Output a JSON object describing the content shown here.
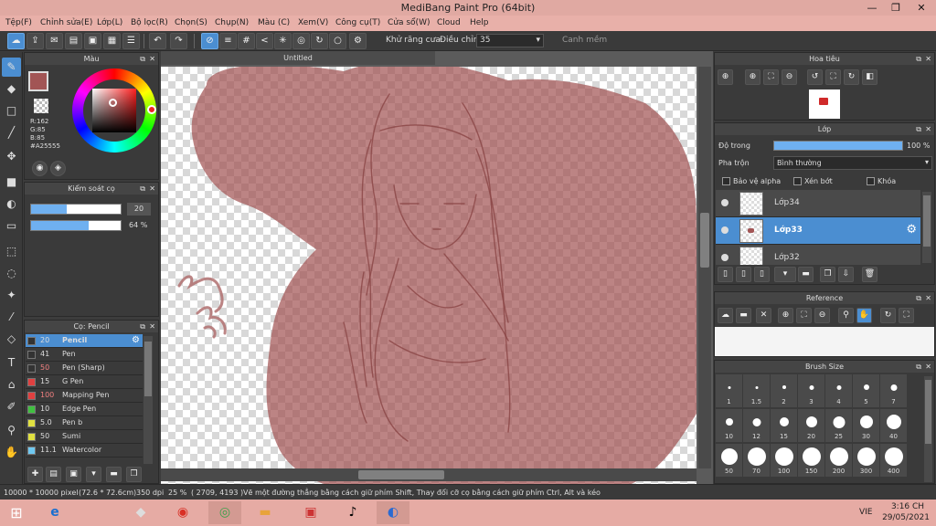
{
  "window": {
    "title": "MediBang Paint Pro (64bit)",
    "minimize": "—",
    "restore": "❐",
    "close": "✕"
  },
  "menu": [
    "Tệp(F)",
    "Chỉnh sửa(E)",
    "Lớp(L)",
    "Bộ lọc(R)",
    "Chọn(S)",
    "Chụp(N)",
    "Màu (C)",
    "Xem(V)",
    "Công cụ(T)",
    "Cửa sổ(W)",
    "Cloud",
    "Help"
  ],
  "toolbar": {
    "antialias_label": "Khử răng cưa",
    "adjust_label": "Điều chỉnh",
    "adjust_value": "35",
    "edge_label": "Canh mềm"
  },
  "color_panel": {
    "title": "Màu",
    "r": "R:162",
    "g": "G:85",
    "b": "B:85",
    "hex": "#A25555",
    "primary": "#A25555"
  },
  "brush_control": {
    "title": "Kiểm soát cọ",
    "size": "20",
    "opacity": "64 %",
    "opacity_value": 0.64,
    "size_value": 0.4
  },
  "brush_panel": {
    "title": "Cọ: Pencil",
    "items": [
      {
        "size": "20",
        "name": "Pencil",
        "color": "#333333"
      },
      {
        "size": "41",
        "name": "Pen",
        "color": "#333333"
      },
      {
        "size": "50",
        "name": "Pen (Sharp)",
        "color": "#333333"
      },
      {
        "size": "15",
        "name": "G Pen",
        "color": "#e04040"
      },
      {
        "size": "100",
        "name": "Mapping Pen",
        "color": "#e04040"
      },
      {
        "size": "10",
        "name": "Edge Pen",
        "color": "#40c040"
      },
      {
        "size": "5.0",
        "name": "Pen b",
        "color": "#e0e040"
      },
      {
        "size": "50",
        "name": "Sumi",
        "color": "#e0e040"
      },
      {
        "size": "11.1",
        "name": "Watercolor",
        "color": "#6fc8f0"
      }
    ]
  },
  "document": {
    "tab": "Untitled"
  },
  "navigator": {
    "title": "Hoa tiêu"
  },
  "layer_panel": {
    "title": "Lớp",
    "opacity_label": "Độ trong",
    "opacity_value": "100 %",
    "blend_label": "Pha trộn",
    "blend_value": "Bình thường",
    "protect_alpha": "Bảo vệ alpha",
    "clipping": "Xén bớt",
    "lock": "Khóa",
    "layers": [
      "Lớp34",
      "Lớp33",
      "Lớp32"
    ]
  },
  "reference": {
    "title": "Reference"
  },
  "brush_size": {
    "title": "Brush Size",
    "sizes": [
      "1",
      "1.5",
      "2",
      "3",
      "4",
      "5",
      "7",
      "10",
      "12",
      "15",
      "20",
      "25",
      "30",
      "40",
      "50",
      "70",
      "100",
      "150",
      "200",
      "300",
      "400"
    ]
  },
  "status": {
    "dims": "10000 * 10000 pixel",
    "phys": "(72.6 * 72.6cm)",
    "dpi": "350 dpi",
    "zoom": "25 %",
    "coords": "( 2709, 4193 )",
    "hint": "Vẽ một đường thẳng bằng cách giữ phím Shift, Thay đổi cỡ cọ bằng cách giữ phím Ctrl, Alt và kéo"
  },
  "taskbar": {
    "lang": "VIE",
    "time": "3:16 CH",
    "date": "29/05/2021"
  }
}
